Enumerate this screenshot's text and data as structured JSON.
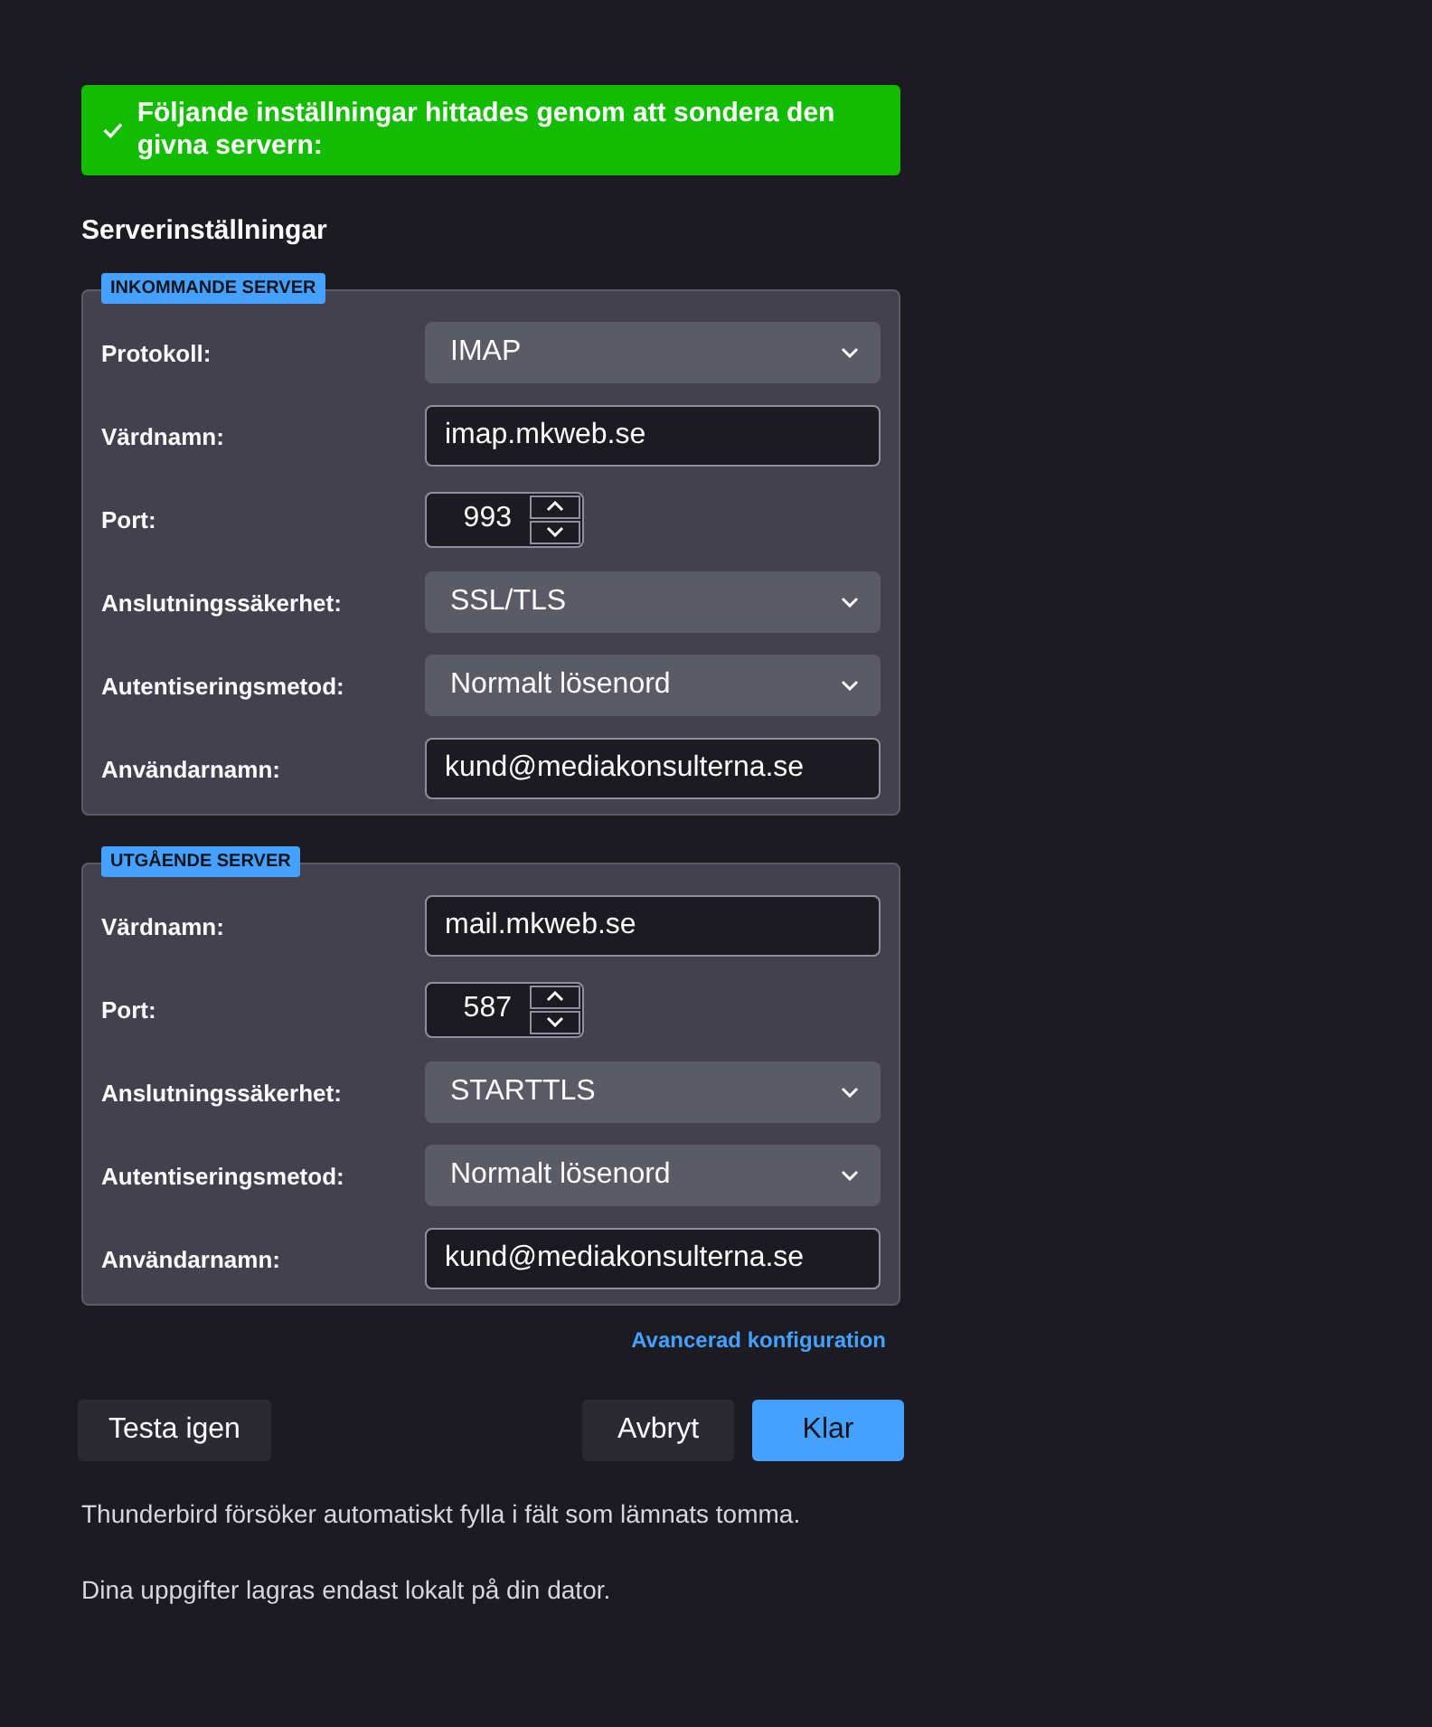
{
  "banner": {
    "text": "Följande inställningar hittades genom att sondera den givna servern:"
  },
  "heading": "Serverinställningar",
  "sections": [
    {
      "legend": "INKOMMANDE SERVER",
      "rows": [
        {
          "kind": "select",
          "label": "Protokoll:",
          "value": "IMAP"
        },
        {
          "kind": "text",
          "label": "Värdnamn:",
          "value": "imap.mkweb.se"
        },
        {
          "kind": "number",
          "label": "Port:",
          "value": "993"
        },
        {
          "kind": "select",
          "label": "Anslutningssäkerhet:",
          "value": "SSL/TLS"
        },
        {
          "kind": "select",
          "label": "Autentiseringsmetod:",
          "value": "Normalt lösenord"
        },
        {
          "kind": "text",
          "label": "Användarnamn:",
          "value": "kund@mediakonsulterna.se"
        }
      ]
    },
    {
      "legend": "UTGÅENDE SERVER",
      "rows": [
        {
          "kind": "text",
          "label": "Värdnamn:",
          "value": "mail.mkweb.se"
        },
        {
          "kind": "number",
          "label": "Port:",
          "value": "587"
        },
        {
          "kind": "select",
          "label": "Anslutningssäkerhet:",
          "value": "STARTTLS"
        },
        {
          "kind": "select",
          "label": "Autentiseringsmetod:",
          "value": "Normalt lösenord"
        },
        {
          "kind": "text",
          "label": "Användarnamn:",
          "value": "kund@mediakonsulterna.se"
        }
      ]
    }
  ],
  "advanced_link": "Avancerad konfiguration",
  "buttons": [
    {
      "label": "Testa igen",
      "kind": "secondary"
    },
    {
      "label": "Avbryt",
      "kind": "secondary"
    },
    {
      "label": "Klar",
      "kind": "primary"
    }
  ],
  "notes": [
    "Thunderbird försöker automatiskt fylla i fält som lämnats tomma.",
    "Dina uppgifter lagras endast lokalt på din dator."
  ]
}
